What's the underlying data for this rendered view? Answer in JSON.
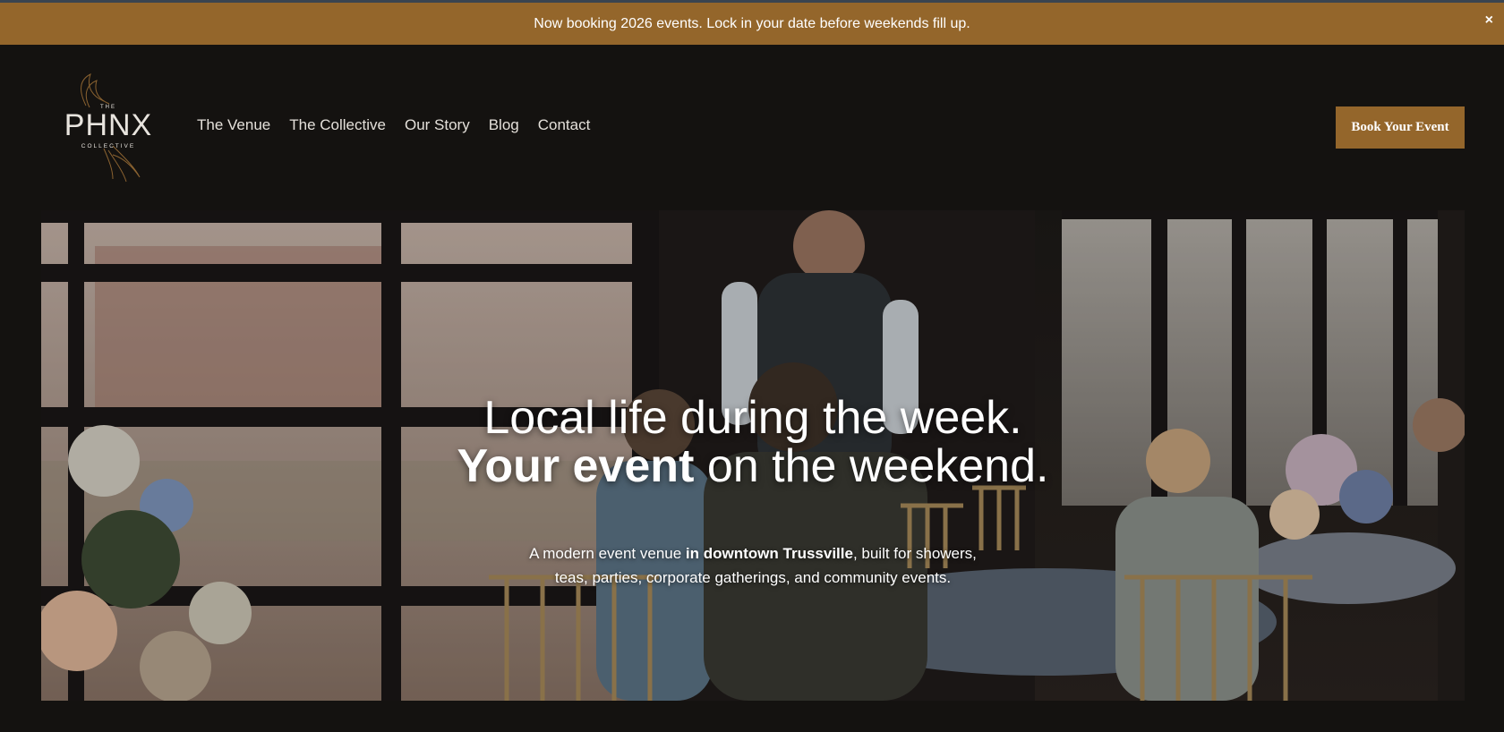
{
  "banner": {
    "text": "Now booking 2026 events. Lock in your date before weekends fill up.",
    "close_icon": "close-icon",
    "close_symbol": "×"
  },
  "logo": {
    "small_top": "THE",
    "main": "PHNX",
    "small_bottom": "COLLECTIVE",
    "icon": "phoenix-wing-icon"
  },
  "nav": {
    "items": [
      {
        "label": "The Venue"
      },
      {
        "label": "The Collective"
      },
      {
        "label": "Our Story"
      },
      {
        "label": "Blog"
      },
      {
        "label": "Contact"
      }
    ]
  },
  "cta": {
    "label": "Book Your Event"
  },
  "hero": {
    "title_line1": "Local life during the week.",
    "title_line2_bold": "Your event",
    "title_line2_rest": " on the weekend.",
    "sub_part1": "A modern event venue ",
    "sub_bold": "in downtown Trussville",
    "sub_part2": ", built for showers,",
    "sub_line2": "teas, parties, corporate gatherings, and community events."
  },
  "colors": {
    "accent": "#94662b",
    "background": "#141210",
    "nav_text": "#e4e0da",
    "logo_text": "#e8e4de"
  }
}
